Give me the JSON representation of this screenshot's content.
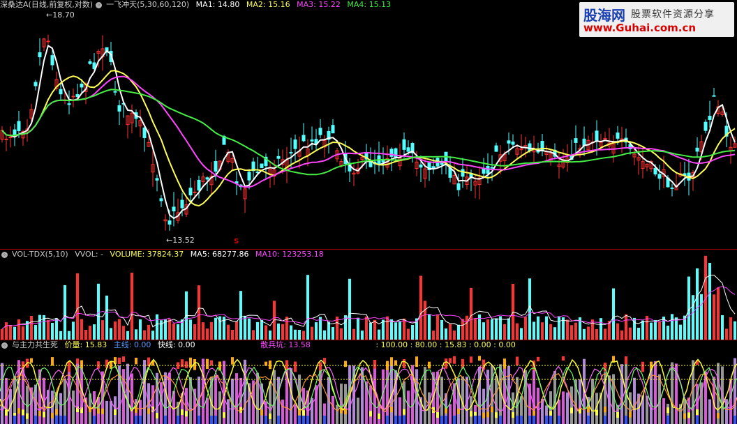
{
  "price_panel": {
    "title": "深桑达A(日线,前复权,对数)",
    "indicator_name": "一飞冲天(5,30,60,120)",
    "ma1": {
      "label": "MA1:",
      "value": "14.80",
      "color": "#ffffff"
    },
    "ma2": {
      "label": "MA2:",
      "value": "15.16",
      "color": "#ffff55"
    },
    "ma3": {
      "label": "MA3:",
      "value": "15.22",
      "color": "#ff44ff"
    },
    "ma4": {
      "label": "MA4:",
      "value": "15.13",
      "color": "#44ee44"
    },
    "high_label": "18.70",
    "low_label": "13.52",
    "signal_mark": "S"
  },
  "volume_panel": {
    "title": "VOL-TDX(5,10)",
    "vvol": "VVOL: -",
    "volume": {
      "label": "VOLUME:",
      "value": "37824.37",
      "color": "#ffff55"
    },
    "ma5": {
      "label": "MA5:",
      "value": "68277.86",
      "color": "#ffffff"
    },
    "ma10": {
      "label": "MA10:",
      "value": "123253.18",
      "color": "#ff44ff"
    }
  },
  "indicator_panel": {
    "title": "与主力共生死",
    "price": {
      "label": "价量:",
      "value": "15.83",
      "color": "#ffff55"
    },
    "main": {
      "label": "主线:",
      "value": "0.00",
      "color": "#5599ff"
    },
    "fast": {
      "label": "快线:",
      "value": "0.00",
      "color": "#ffffff"
    },
    "retail": {
      "label": "散兵坑:",
      "value": "13.58",
      "color": "#ff44ff"
    },
    "extra": ": 100.00 : 80.00 : 15.83 : 0.00 : 0.00"
  },
  "watermark": {
    "brand": "股海网",
    "slogan": "股票软件资源分享",
    "url": "www.Guhai.com.cn"
  },
  "colors": {
    "up": "#ff3232",
    "down": "#54ffff",
    "background": "#000000"
  }
}
